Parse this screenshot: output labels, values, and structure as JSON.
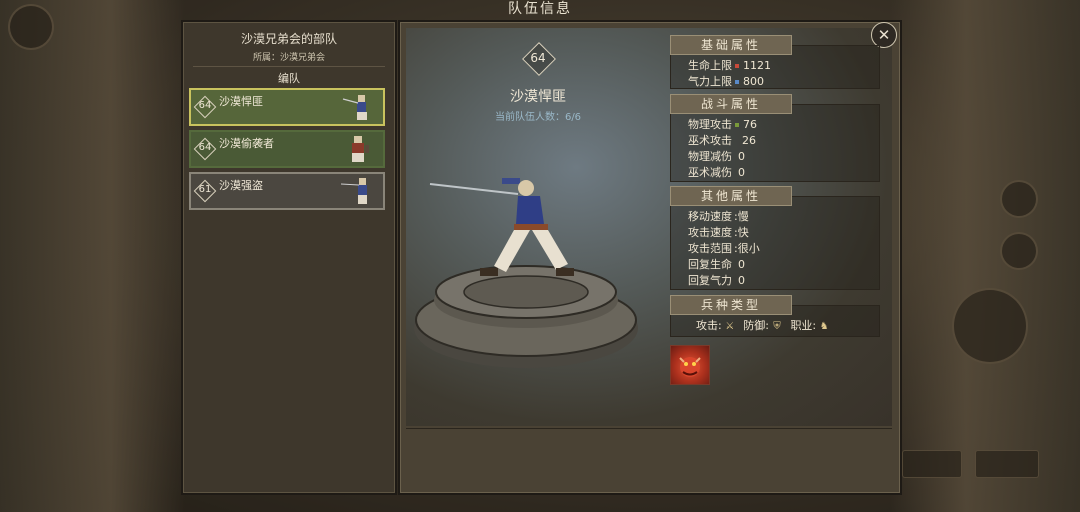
{
  "window_title": "队伍信息",
  "close_icon": "close-x-icon",
  "left_panel": {
    "troop_name": "沙漠兄弟会的部队",
    "belong": "所属：沙漠兄弟会",
    "group_label": "编队",
    "units": [
      {
        "level": "64",
        "name": "沙漠悍匪",
        "state": "selected"
      },
      {
        "level": "64",
        "name": "沙漠偷袭者",
        "state": "green"
      },
      {
        "level": "61",
        "name": "沙漠强盗",
        "state": "gray"
      }
    ]
  },
  "detail": {
    "level": "64",
    "name": "沙漠悍匪",
    "team_count": "当前队伍人数：6/6"
  },
  "sections": {
    "basic": {
      "title": "基础属性",
      "hp_label": "生命上限",
      "hp_value": "1121",
      "hp_color": "#c84a3a",
      "qi_label": "气力上限",
      "qi_value": "800",
      "qi_color": "#5a8ac8"
    },
    "combat": {
      "title": "战斗属性",
      "rows": [
        {
          "label": "物理攻击",
          "value": "76",
          "color": "#7a9a3a"
        },
        {
          "label": "巫术攻击",
          "value": "26",
          "color": ""
        },
        {
          "label": "物理减伤",
          "value": "0",
          "color": ""
        },
        {
          "label": "巫术减伤",
          "value": "0",
          "color": ""
        }
      ]
    },
    "other": {
      "title": "其他属性",
      "rows": [
        {
          "label": "移动速度",
          "value": ":慢"
        },
        {
          "label": "攻击速度",
          "value": ":快"
        },
        {
          "label": "攻击范围",
          "value": ":很小"
        },
        {
          "label": "回复生命",
          "value": "0"
        },
        {
          "label": "回复气力",
          "value": "0"
        }
      ]
    },
    "troop_type": {
      "title": "兵种类型",
      "attack_label": "攻击:",
      "attack_icon": "sword-icon",
      "defense_label": "防御:",
      "defense_icon": "shield-icon",
      "job_label": "职业:",
      "job_icon": "bandit-icon"
    }
  },
  "skill_icon": "red-demon-skill-icon"
}
